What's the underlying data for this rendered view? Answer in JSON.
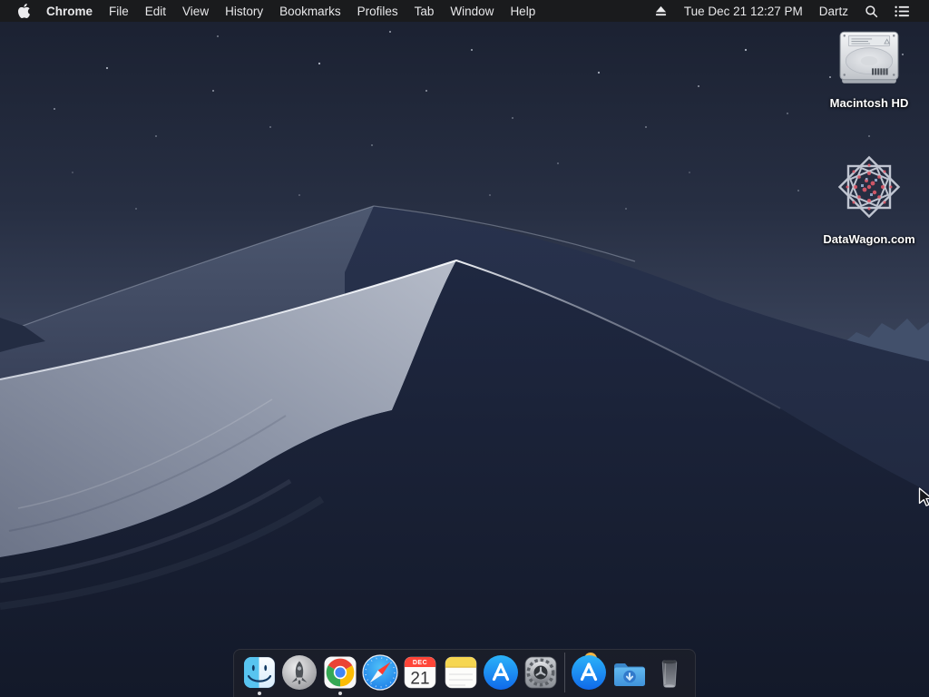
{
  "menu_bar": {
    "app_name": "Chrome",
    "items": [
      "File",
      "Edit",
      "View",
      "History",
      "Bookmarks",
      "Profiles",
      "Tab",
      "Window",
      "Help"
    ],
    "status": {
      "clock": "Tue Dec 21 12:27 PM",
      "user": "Dartz"
    },
    "icons": {
      "apple": "apple-logo",
      "eject": "eject",
      "spotlight": "magnifier",
      "notification": "list-lines"
    }
  },
  "desktop": {
    "wallpaper": "mojave-night-dunes",
    "icons": [
      {
        "label": "Macintosh HD",
        "icon": "internal-hard-drive"
      },
      {
        "label": "DataWagon.com",
        "icon": "web-location-mandala"
      }
    ]
  },
  "dock": {
    "items": [
      {
        "name": "finder",
        "running": true
      },
      {
        "name": "launchpad",
        "running": false
      },
      {
        "name": "chrome",
        "running": true
      },
      {
        "name": "safari",
        "running": false
      },
      {
        "name": "calendar",
        "running": false,
        "month": "DEC",
        "day": "21"
      },
      {
        "name": "notes",
        "running": false
      },
      {
        "name": "app-store",
        "running": false
      },
      {
        "name": "system-preferences",
        "running": false
      },
      {
        "name": "app-store-recent",
        "running": false
      },
      {
        "name": "downloads-folder",
        "running": false
      },
      {
        "name": "trash",
        "running": false
      }
    ]
  },
  "colors": {
    "menubar_bg": "#1b1b1d",
    "menubar_text": "#e7e7e9",
    "dock_bg": "rgba(30,32,40,0.62)",
    "sky_top": "#1a2030",
    "sky_horizon": "#5d6880",
    "dune_bright": "#b6bcc9",
    "dune_dark": "#1c2439",
    "label_text": "#ffffff",
    "calendar_red": "#ff4538",
    "app_store_blue": "#1d9bf6"
  }
}
